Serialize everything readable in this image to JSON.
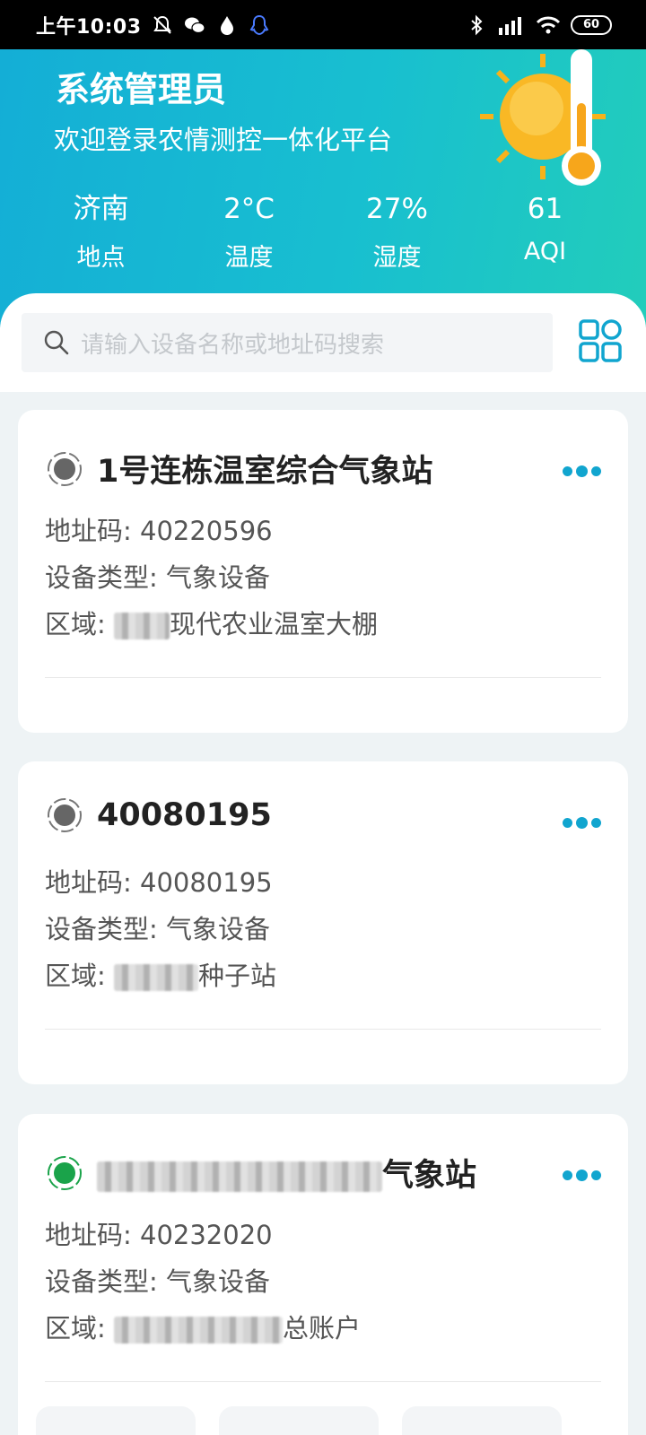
{
  "status_bar": {
    "time": "上午10:03",
    "battery": "60"
  },
  "header": {
    "user_name": "系统管理员",
    "welcome": "欢迎登录农情测控一体化平台",
    "stats": [
      {
        "value": "济南",
        "label": "地点"
      },
      {
        "value": "2°C",
        "label": "温度"
      },
      {
        "value": "27%",
        "label": "湿度"
      },
      {
        "value": "61",
        "label": "AQI"
      }
    ]
  },
  "search": {
    "placeholder": "请输入设备名称或地址码搜索"
  },
  "devices": [
    {
      "title": "1号连栋温室综合气象站",
      "status": "offline",
      "address_label": "地址码:",
      "address": "40220596",
      "type_label": "设备类型:",
      "type": "气象设备",
      "area_label": "区域:",
      "area": "现代农业温室大棚"
    },
    {
      "title": "40080195",
      "status": "offline",
      "address_label": "地址码:",
      "address": "40080195",
      "type_label": "设备类型:",
      "type": "气象设备",
      "area_label": "区域:",
      "area": "种子站"
    },
    {
      "title": "气象站",
      "status": "online",
      "address_label": "地址码:",
      "address": "40232020",
      "type_label": "设备类型:",
      "type": "气象设备",
      "area_label": "区域:",
      "area": "总账户"
    }
  ],
  "colors": {
    "accent": "#11a5cf",
    "online": "#1aa34a",
    "offline": "#666666"
  }
}
